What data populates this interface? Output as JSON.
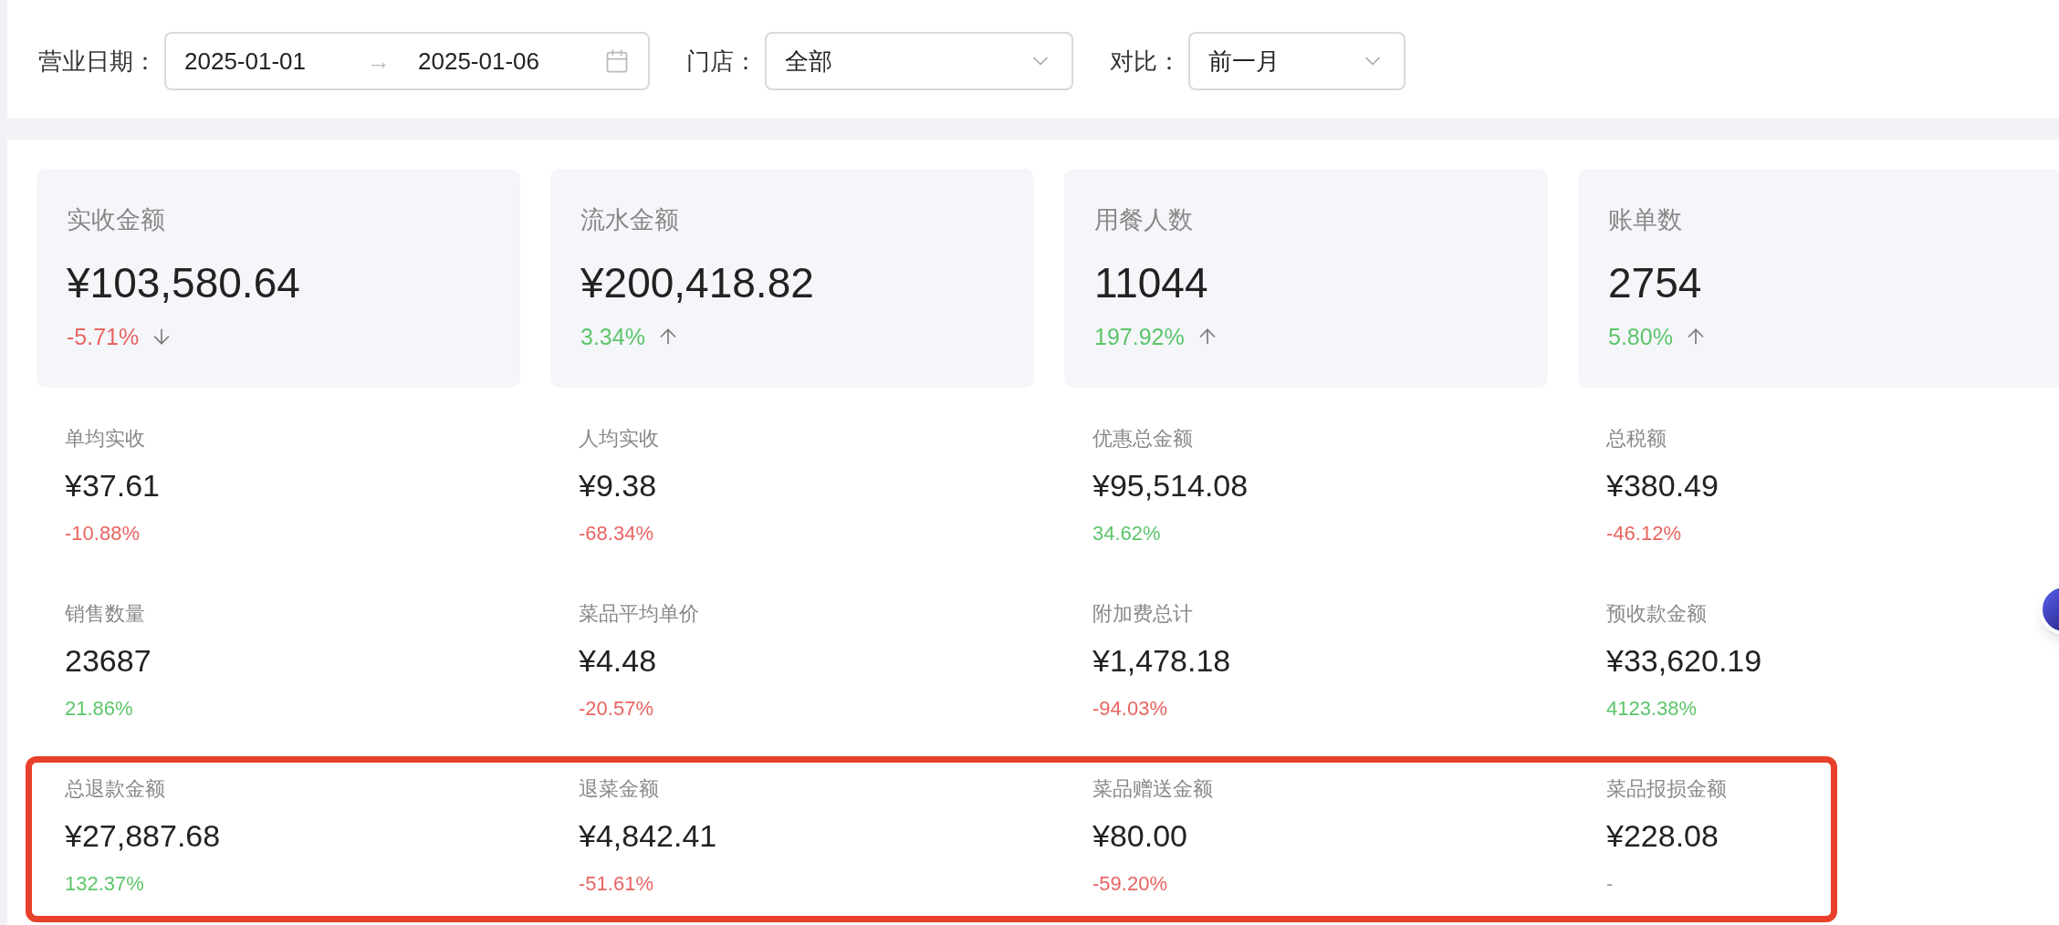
{
  "filters": {
    "date": {
      "label": "营业日期：",
      "start": "2025-01-01",
      "separator": "→",
      "end": "2025-01-06"
    },
    "store": {
      "label": "门店：",
      "value": "全部"
    },
    "compare": {
      "label": "对比：",
      "value": "前一月"
    }
  },
  "summary_cards": [
    {
      "label": "实收金额",
      "value": "¥103,580.64",
      "change": "-5.71%",
      "kind": "down"
    },
    {
      "label": "流水金额",
      "value": "¥200,418.82",
      "change": "3.34%",
      "kind": "up"
    },
    {
      "label": "用餐人数",
      "value": "11044",
      "change": "197.92%",
      "kind": "up"
    },
    {
      "label": "账单数",
      "value": "2754",
      "change": "5.80%",
      "kind": "up"
    }
  ],
  "metric_rows": [
    {
      "highlighted": false,
      "metrics": [
        {
          "label": "单均实收",
          "value": "¥37.61",
          "change": "-10.88%",
          "kind": "down"
        },
        {
          "label": "人均实收",
          "value": "¥9.38",
          "change": "-68.34%",
          "kind": "down"
        },
        {
          "label": "优惠总金额",
          "value": "¥95,514.08",
          "change": "34.62%",
          "kind": "up"
        },
        {
          "label": "总税额",
          "value": "¥380.49",
          "change": "-46.12%",
          "kind": "down"
        }
      ]
    },
    {
      "highlighted": false,
      "metrics": [
        {
          "label": "销售数量",
          "value": "23687",
          "change": "21.86%",
          "kind": "up"
        },
        {
          "label": "菜品平均单价",
          "value": "¥4.48",
          "change": "-20.57%",
          "kind": "down"
        },
        {
          "label": "附加费总计",
          "value": "¥1,478.18",
          "change": "-94.03%",
          "kind": "down"
        },
        {
          "label": "预收款金额",
          "value": "¥33,620.19",
          "change": "4123.38%",
          "kind": "up"
        }
      ]
    },
    {
      "highlighted": true,
      "metrics": [
        {
          "label": "总退款金额",
          "value": "¥27,887.68",
          "change": "132.37%",
          "kind": "up"
        },
        {
          "label": "退菜金额",
          "value": "¥4,842.41",
          "change": "-51.61%",
          "kind": "down"
        },
        {
          "label": "菜品赠送金额",
          "value": "¥80.00",
          "change": "-59.20%",
          "kind": "down"
        },
        {
          "label": "菜品报损金额",
          "value": "¥228.08",
          "change": "-",
          "kind": "none"
        }
      ]
    }
  ]
}
